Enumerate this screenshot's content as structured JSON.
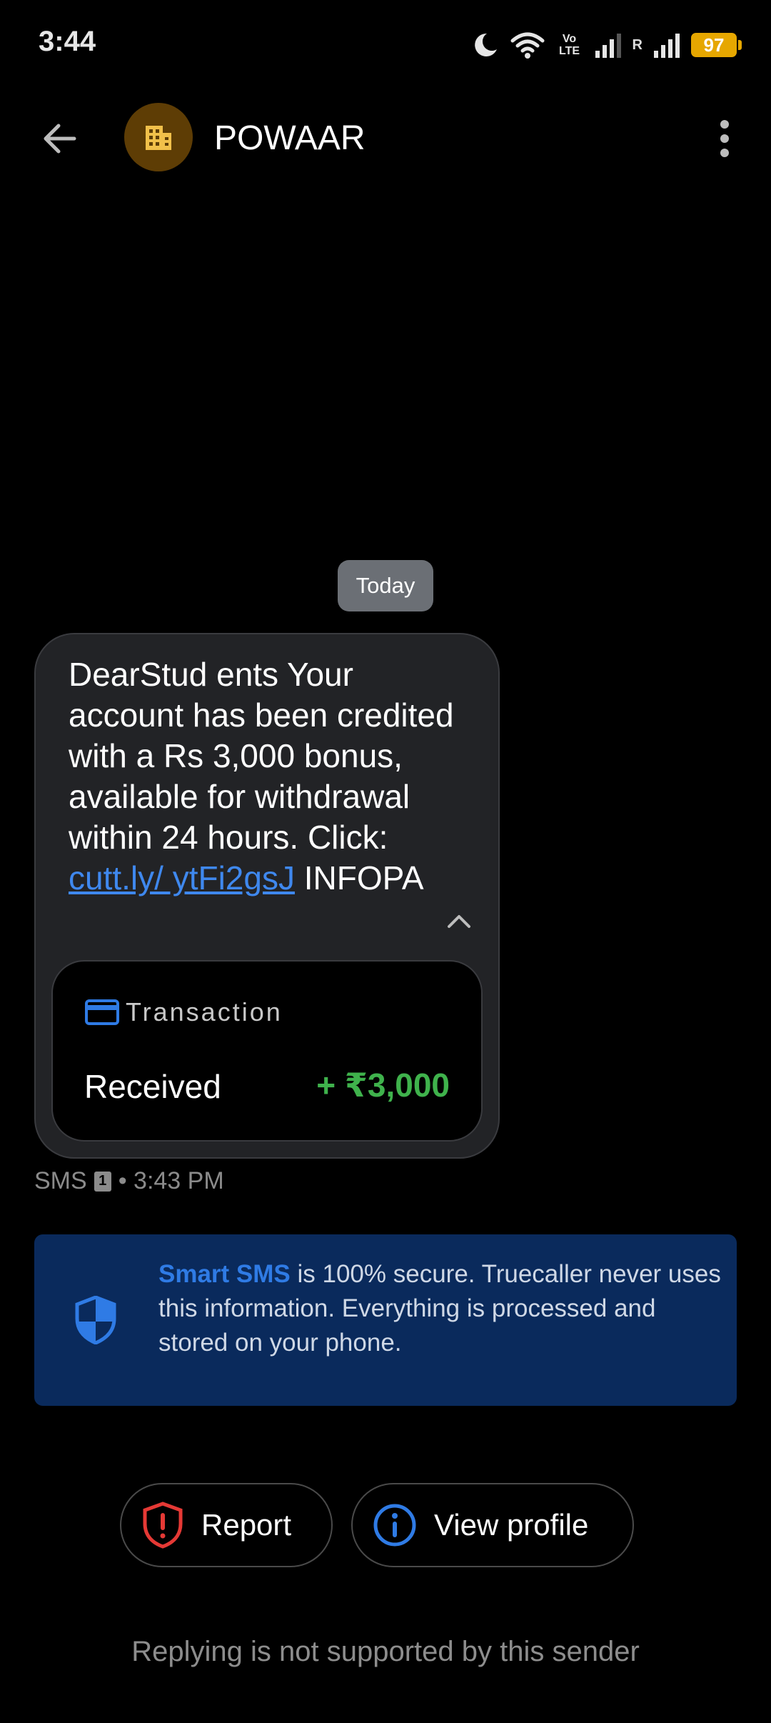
{
  "status_bar": {
    "time": "3:44",
    "battery": "97",
    "network_label": "Vo LTE",
    "roaming": "R"
  },
  "header": {
    "contact_name": "POWAAR"
  },
  "conversation": {
    "date_chip": "Today",
    "message": {
      "text_before_link": "DearStud ents Your account has been credited with a Rs 3,000 bonus, available for withdrawal within 24 hours. Click: ",
      "link_text": "cutt.ly/ ytFi2gsJ",
      "text_after_link": " INFOPA"
    },
    "transaction": {
      "label": "Transaction",
      "type": "Received",
      "amount": "+ ₹3,000"
    },
    "meta": {
      "channel": "SMS",
      "sim": "1",
      "time": "• 3:43 PM"
    }
  },
  "banner": {
    "highlight": "Smart SMS",
    "text": " is 100% secure. Truecaller never uses this information. Everything is processed and stored on your phone."
  },
  "actions": {
    "report_label": "Report",
    "view_profile_label": "View profile"
  },
  "footer": {
    "note": "Replying is not supported by this sender"
  },
  "colors": {
    "background": "#000000",
    "bubble": "#222326",
    "link": "#3f88ee",
    "amount": "#3fb24c",
    "banner": "#0a2a5c",
    "accent_blue": "#2f7be5",
    "report_red": "#e53935",
    "battery": "#e6a700"
  }
}
